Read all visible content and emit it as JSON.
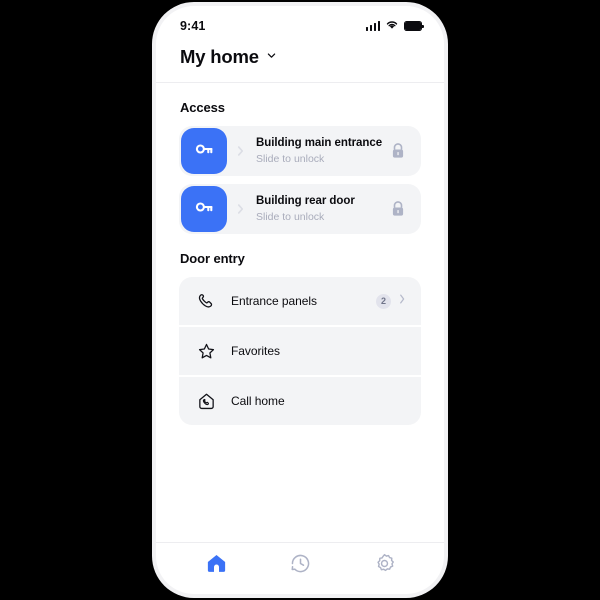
{
  "status_bar": {
    "time": "9:41",
    "signal_icon": "signal-bars-icon",
    "wifi_icon": "wifi-icon",
    "battery_icon": "battery-icon"
  },
  "header": {
    "title": "My home",
    "dropdown_icon": "chevron-down-icon"
  },
  "access": {
    "section_title": "Access",
    "items": [
      {
        "name": "Building main entrance",
        "hint": "Slide to unlock",
        "key_icon": "key-icon",
        "slide_icon": "chevron-right-icon",
        "lock_icon": "lock-closed-icon"
      },
      {
        "name": "Building rear door",
        "hint": "Slide to unlock",
        "key_icon": "key-icon",
        "slide_icon": "chevron-right-icon",
        "lock_icon": "lock-closed-icon"
      }
    ]
  },
  "door_entry": {
    "section_title": "Door entry",
    "items": [
      {
        "label": "Entrance panels",
        "icon": "phone-handset-icon",
        "badge": "2",
        "chevron": "chevron-right-icon"
      },
      {
        "label": "Favorites",
        "icon": "star-outline-icon",
        "badge": "",
        "chevron": ""
      },
      {
        "label": "Call home",
        "icon": "home-call-icon",
        "badge": "",
        "chevron": ""
      }
    ]
  },
  "tab_bar": {
    "items": [
      {
        "name": "home",
        "icon": "home-icon",
        "active": true
      },
      {
        "name": "history",
        "icon": "history-clock-icon",
        "active": false
      },
      {
        "name": "settings",
        "icon": "gear-icon",
        "active": false
      }
    ]
  },
  "colors": {
    "accent_blue": "#3b72f6",
    "card_gray": "#f3f4f6",
    "muted_text": "#a9acbb",
    "badge_bg": "#e2e3ec",
    "icon_gray": "#aeb3c6",
    "text_dark": "#0b0b0f"
  }
}
